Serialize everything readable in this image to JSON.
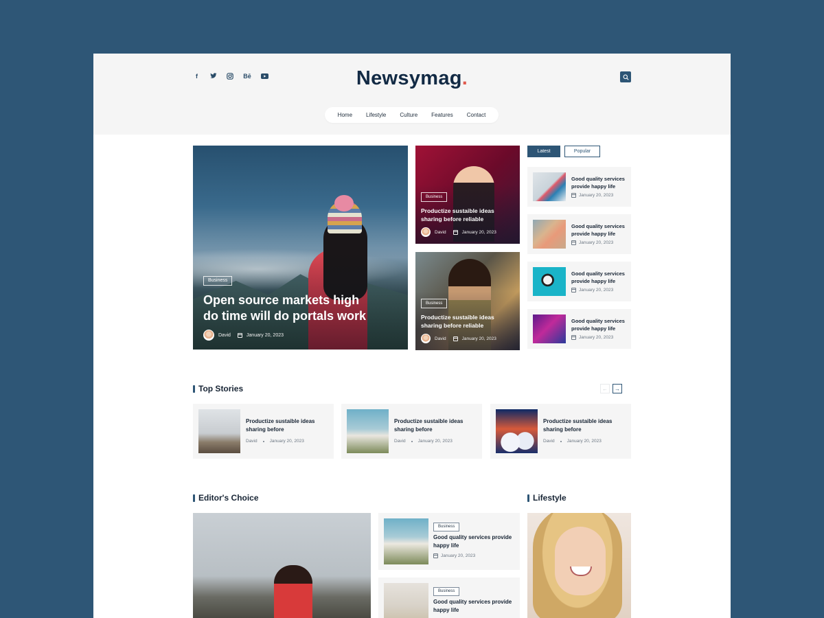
{
  "site": {
    "logo_text": "Newsymag",
    "logo_dot": ".",
    "accent_color": "#2d5575",
    "dot_color": "#e05a4e"
  },
  "socials": [
    {
      "icon": "facebook-icon",
      "glyph": "f"
    },
    {
      "icon": "twitter-icon",
      "glyph": "t"
    },
    {
      "icon": "instagram-icon",
      "glyph": "◎"
    },
    {
      "icon": "behance-icon",
      "glyph": "Bē"
    },
    {
      "icon": "youtube-icon",
      "glyph": "▶"
    }
  ],
  "nav": {
    "items": [
      "Home",
      "Lifestyle",
      "Culture",
      "Features",
      "Contact"
    ]
  },
  "hero": {
    "badge": "Business",
    "title": "Open source markets high do time will do portals work",
    "author": "David",
    "date": "January 20, 2023"
  },
  "mid_cards": [
    {
      "badge": "Business",
      "title": "Productize sustaible ideas sharing before reliable",
      "author": "David",
      "date": "January 20, 2023"
    },
    {
      "badge": "Business",
      "title": "Productize sustaible ideas sharing before reliable",
      "author": "David",
      "date": "January 20, 2023"
    }
  ],
  "sidebar": {
    "tabs": [
      "Latest",
      "Popular"
    ],
    "items": [
      {
        "title": "Good quality services provide happy life",
        "date": "January 20, 2023"
      },
      {
        "title": "Good quality services provide happy life",
        "date": "January 20, 2023"
      },
      {
        "title": "Good quality services provide happy life",
        "date": "January 20, 2023"
      },
      {
        "title": "Good quality services provide happy life",
        "date": "January 20, 2023"
      }
    ]
  },
  "top_stories": {
    "heading": "Top Stories",
    "prev": "←",
    "next": "→",
    "items": [
      {
        "title": "Productize sustaible ideas sharing before",
        "author": "David",
        "date": "January 20, 2023"
      },
      {
        "title": "Productize sustaible ideas sharing before",
        "author": "David",
        "date": "January 20, 2023"
      },
      {
        "title": "Productize sustaible ideas sharing before",
        "author": "David",
        "date": "January 20, 2023"
      }
    ]
  },
  "editors_choice": {
    "heading": "Editor's Choice",
    "items": [
      {
        "badge": "Business",
        "title": "Good quality services provide happy life",
        "date": "January 20, 2023"
      },
      {
        "badge": "Business",
        "title": "Good quality services provide happy life"
      }
    ]
  },
  "lifestyle": {
    "heading": "Lifestyle"
  }
}
